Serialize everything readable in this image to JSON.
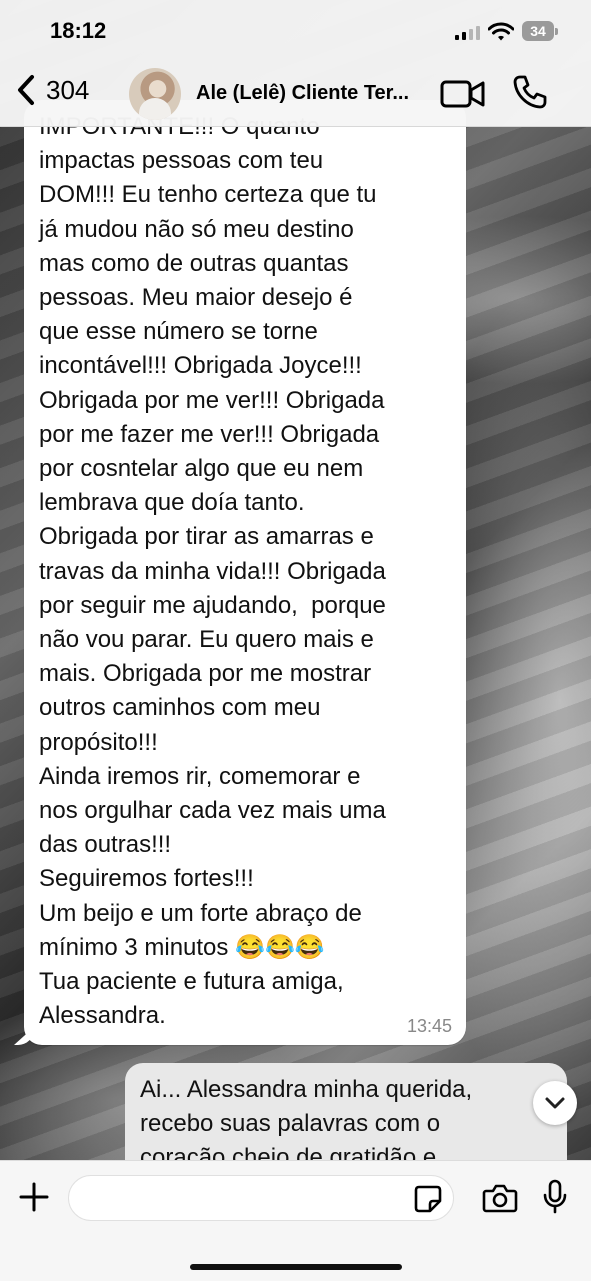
{
  "status_bar": {
    "time": "18:12",
    "battery": "34"
  },
  "header": {
    "back_count": "304",
    "contact_name": "Ale (Lelê) Cliente Ter..."
  },
  "messages": {
    "incoming": {
      "text": "IMPORTANTE!!! O quanto\nimpactas pessoas com teu\nDOM!!! Eu tenho certeza que tu\njá mudou não só meu destino\nmas como de outras quantas\npessoas. Meu maior desejo é\nque esse número se torne\nincontável!!! Obrigada Joyce!!!\nObrigada por me ver!!! Obrigada\npor me fazer me ver!!! Obrigada\npor cosntelar algo que eu nem\nlembrava que doía tanto.\nObrigada por tirar as amarras e\ntravas da minha vida!!! Obrigada\npor seguir me ajudando,  porque\nnão vou parar. Eu quero mais e\nmais. Obrigada por me mostrar\noutros caminhos com meu\npropósito!!!\nAinda iremos rir, comemorar e\nnos orgulhar cada vez mais uma\ndas outras!!!\nSeguiremos fortes!!!\nUm beijo e um forte abraço de\nmínimo 3 minutos 😂😂😂\nTua paciente e futura amiga,\nAlessandra.",
      "time": "13:45"
    },
    "outgoing": {
      "text": "Ai... Alessandra minha querida,\nrecebo suas palavras com o\ncoração cheio de gratidão e"
    }
  },
  "composer": {
    "placeholder": ""
  },
  "icons": {
    "back": "chevron-left-icon",
    "video": "video-camera-icon",
    "call": "phone-icon",
    "plus": "plus-icon",
    "sticker": "sticker-icon",
    "camera": "camera-icon",
    "mic": "microphone-icon",
    "scroll": "chevron-down-icon"
  },
  "colors": {
    "incoming_bubble": "#ffffff",
    "outgoing_bubble": "#e8e8e8",
    "header_bg": "#f6f6f6"
  }
}
